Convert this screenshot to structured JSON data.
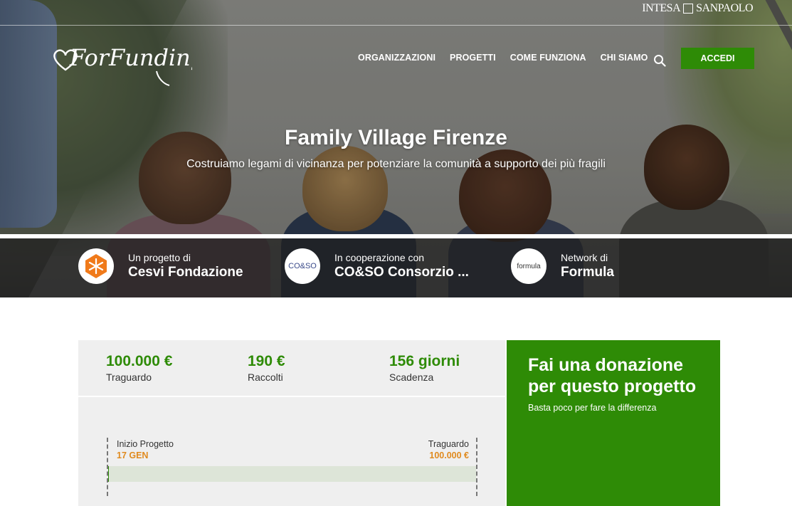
{
  "brand": {
    "logo_text": "ForFunding",
    "bank_name_left": "INTESA",
    "bank_name_right": "SANPAOLO"
  },
  "nav": {
    "items": [
      {
        "label": "ORGANIZZAZIONI"
      },
      {
        "label": "PROGETTI"
      },
      {
        "label": "COME FUNZIONA"
      },
      {
        "label": "CHI SIAMO"
      }
    ],
    "search_icon": "search-icon",
    "login_label": "ACCEDI"
  },
  "hero": {
    "title": "Family Village Firenze",
    "subtitle": "Costruiamo legami di vicinanza per potenziare la comunità a supporto dei più fragili"
  },
  "partners": [
    {
      "caption": "Un progetto di",
      "name": "Cesvi Fondazione",
      "logo_text": ""
    },
    {
      "caption": "In cooperazione con",
      "name": "CO&SO Consorzio ...",
      "logo_text": "CO&SO"
    },
    {
      "caption": "Network di",
      "name": "Formula",
      "logo_text": "formula"
    }
  ],
  "stats": [
    {
      "value": "100.000 €",
      "label": "Traguardo"
    },
    {
      "value": "190 €",
      "label": "Raccolti"
    },
    {
      "value": "156 giorni",
      "label": "Scadenza"
    }
  ],
  "timeline": {
    "start_caption": "Inizio Progetto",
    "start_value": "17 GEN",
    "end_caption": "Traguardo",
    "end_value": "100.000 €",
    "progress_fraction": 0.0019
  },
  "donate": {
    "title": "Fai una donazione per questo progetto",
    "subtitle": "Basta poco per fare la differenza"
  },
  "colors": {
    "accent_green": "#2e8b06",
    "timeline_orange": "#e08a1e"
  }
}
